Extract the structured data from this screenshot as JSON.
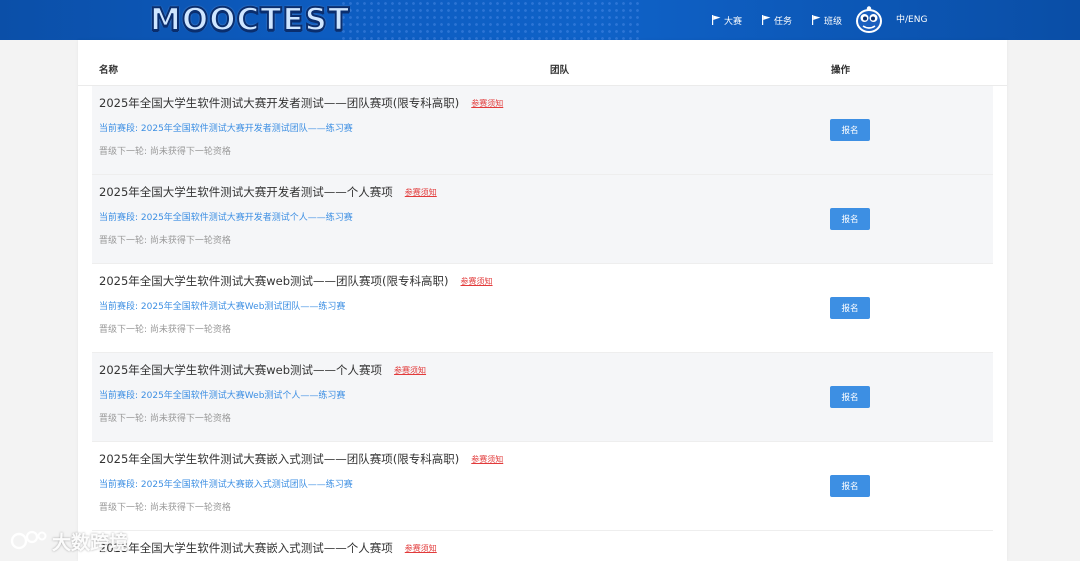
{
  "header": {
    "logo_text": "MOOCTEST",
    "nav": [
      {
        "label": "大赛",
        "icon": "flag-icon"
      },
      {
        "label": "任务",
        "icon": "flag-icon"
      },
      {
        "label": "班级",
        "icon": "flag-icon"
      }
    ],
    "language_toggle": "中/ENG",
    "colors": {
      "header_bg": "#0d5cc0",
      "accent": "#3d8fe3",
      "link_red": "#e23a3a"
    }
  },
  "table": {
    "columns": [
      "名称",
      "团队",
      "操作"
    ],
    "rows": [
      {
        "title": "2025年全国大学生软件测试大赛开发者测试——团队赛项(限专科高职)",
        "add_link": "参赛须知",
        "stage": "当前赛段: 2025年全国软件测试大赛开发者测试团队——练习赛",
        "next_round": "晋级下一轮: 尚未获得下一轮资格",
        "action": "报名"
      },
      {
        "title": "2025年全国大学生软件测试大赛开发者测试——个人赛项",
        "add_link": "参赛须知",
        "stage": "当前赛段: 2025年全国软件测试大赛开发者测试个人——练习赛",
        "next_round": "晋级下一轮: 尚未获得下一轮资格",
        "action": "报名"
      },
      {
        "title": "2025年全国大学生软件测试大赛web测试——团队赛项(限专科高职)",
        "add_link": "参赛须知",
        "stage": "当前赛段: 2025年全国软件测试大赛Web测试团队——练习赛",
        "next_round": "晋级下一轮: 尚未获得下一轮资格",
        "action": "报名"
      },
      {
        "title": "2025年全国大学生软件测试大赛web测试——个人赛项",
        "add_link": "参赛须知",
        "stage": "当前赛段: 2025年全国软件测试大赛Web测试个人——练习赛",
        "next_round": "晋级下一轮: 尚未获得下一轮资格",
        "action": "报名"
      },
      {
        "title": "2025年全国大学生软件测试大赛嵌入式测试——团队赛项(限专科高职)",
        "add_link": "参赛须知",
        "stage": "当前赛段: 2025年全国软件测试大赛嵌入式测试团队——练习赛",
        "next_round": "晋级下一轮: 尚未获得下一轮资格",
        "action": "报名"
      },
      {
        "title": "2025年全国大学生软件测试大赛嵌入式测试——个人赛项",
        "add_link": "参赛须知"
      }
    ]
  },
  "watermark": {
    "text": "大数跨境"
  }
}
